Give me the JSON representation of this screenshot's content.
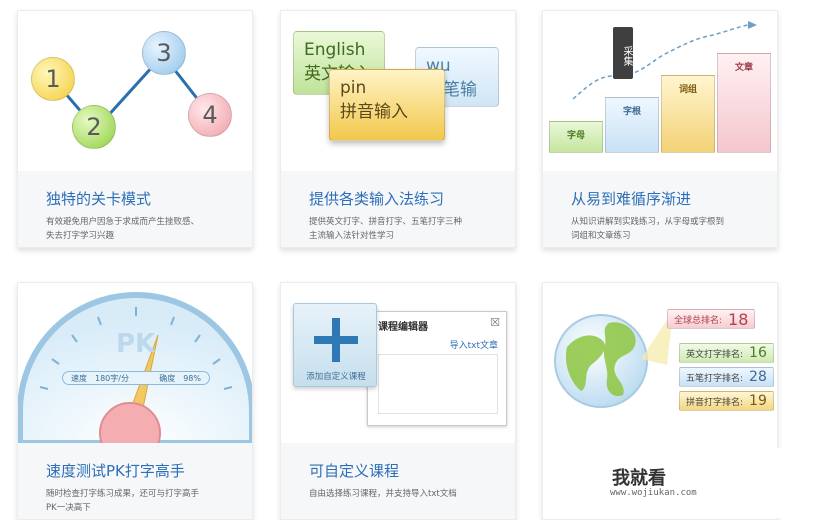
{
  "cards": [
    {
      "title": "独特的关卡模式",
      "desc": "有效避免用户因急于求成而产生挫败感、\n失去打字学习兴趣",
      "nodes": [
        "1",
        "2",
        "3",
        "4"
      ]
    },
    {
      "title": "提供各类输入法练习",
      "desc": "提供英文打字、拼音打字、五笔打字三种\n主流输入法针对性学习",
      "english": "English\n英文输入",
      "wubi": "wu\n五笔输入",
      "pinyin": "pin\n拼音输入"
    },
    {
      "title": "从易到难循序渐进",
      "desc": "从知识讲解到实践练习，从字母或字根到\n词组和文章练习",
      "bars": [
        "字母",
        "字根",
        "词组",
        "文章"
      ],
      "tag": "采集"
    },
    {
      "title": "速度测试PK打字高手",
      "desc": "随时检查打字练习成果，还可与打字高手\nPK一决高下",
      "dial_text": "PK",
      "speed": "速度　180字/分",
      "accuracy": "确度　98%"
    },
    {
      "title": "可自定义课程",
      "desc": "自由选择练习课程，并支持导入txt文档",
      "editor_title": "课程编辑器",
      "close": "☒",
      "import_label": "导入txt文章",
      "add_label": "添加自定义课程"
    },
    {
      "ranks": [
        {
          "label": "全球总排名:",
          "value": "18"
        },
        {
          "label": "英文打字排名:",
          "value": "16"
        },
        {
          "label": "五笔打字排名:",
          "value": "28"
        },
        {
          "label": "拼音打字排名:",
          "value": "19"
        }
      ]
    }
  ],
  "watermark": {
    "brand": "我就看",
    "url": "www.wojiukan.com"
  }
}
